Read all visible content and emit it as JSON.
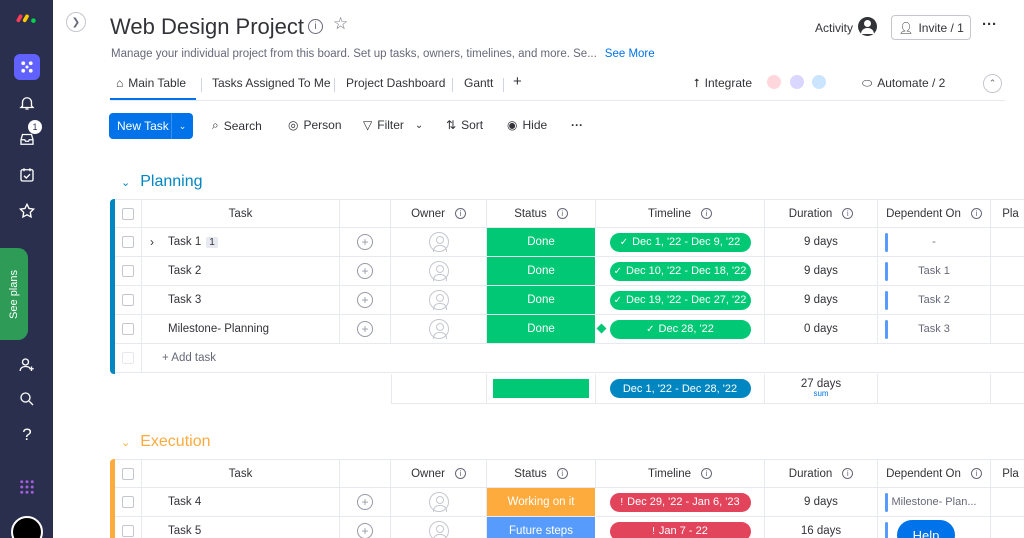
{
  "rail": {
    "badge": "1",
    "see_plans": "See plans",
    "help_icon": "?"
  },
  "header": {
    "title": "Web Design Project",
    "description": "Manage your individual project from this board. Set up tasks, owners, timelines, and more. Se...",
    "see_more": "See More",
    "activity": "Activity",
    "invite": "Invite / 1",
    "more": "···"
  },
  "tabs": {
    "main_table": "Main Table",
    "assigned": "Tasks Assigned To Me",
    "dashboard": "Project Dashboard",
    "gantt": "Gantt",
    "add": "+",
    "integrate": "Integrate",
    "automate": "Automate / 2"
  },
  "toolbar": {
    "new_task": "New Task",
    "search": "Search",
    "person": "Person",
    "filter": "Filter",
    "sort": "Sort",
    "hide": "Hide",
    "more": "···"
  },
  "columns": {
    "task": "Task",
    "owner": "Owner",
    "status": "Status",
    "timeline": "Timeline",
    "duration": "Duration",
    "dependent_on": "Dependent On",
    "plan": "Pla"
  },
  "colors": {
    "accent": "#0073ea",
    "done": "#00c875",
    "working": "#fdab3d",
    "future": "#579bfc",
    "overdue": "#e2445c",
    "planning": "#0086c0",
    "execution": "#fdab3d"
  },
  "planning": {
    "name": "Planning",
    "add_task": "+ Add task",
    "rows": [
      {
        "task": "Task 1",
        "subitems": "1",
        "status": "Done",
        "timeline": "Dec 1, '22 - Dec 9, '22",
        "duration": "9 days",
        "dependent": "-"
      },
      {
        "task": "Task 2",
        "status": "Done",
        "timeline": "Dec 10, '22 - Dec 18, '22",
        "duration": "9 days",
        "dependent": "Task 1"
      },
      {
        "task": "Task 3",
        "status": "Done",
        "timeline": "Dec 19, '22 - Dec 27, '22",
        "duration": "9 days",
        "dependent": "Task 2"
      },
      {
        "task": "Milestone- Planning",
        "status": "Done",
        "timeline": "Dec 28, '22",
        "duration": "0 days",
        "dependent": "Task 3"
      }
    ],
    "summary": {
      "timeline": "Dec 1, '22 - Dec 28, '22",
      "duration": "27 days",
      "duration_label": "sum"
    }
  },
  "execution": {
    "name": "Execution",
    "rows": [
      {
        "task": "Task 4",
        "status": "Working on it",
        "timeline": "Dec 29, '22 - Jan 6, '23",
        "duration": "9 days",
        "dependent": "Milestone- Plan..."
      },
      {
        "task": "Task 5",
        "status": "Future steps",
        "timeline": "Jan 7 - 22",
        "duration": "16 days",
        "dependent": ""
      }
    ]
  },
  "help": "Help"
}
